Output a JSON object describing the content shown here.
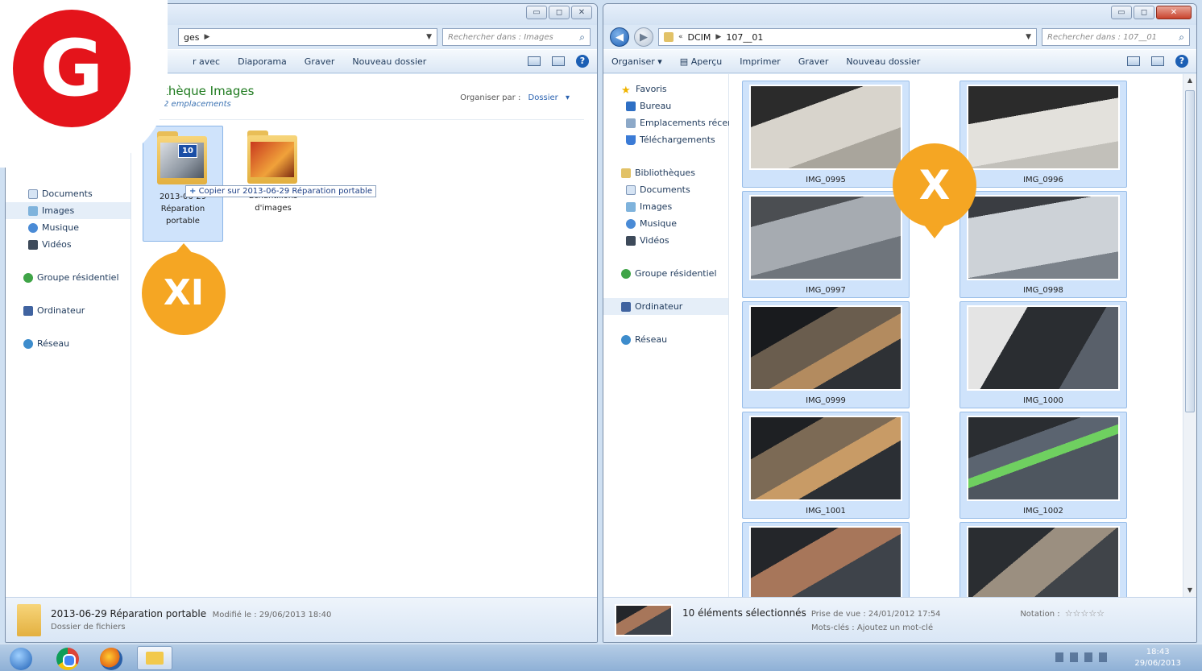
{
  "left_window": {
    "address": "ges",
    "search_placeholder": "Rechercher dans : Images",
    "toolbar": {
      "share": "r avec",
      "slideshow": "Diaporama",
      "burn": "Graver",
      "new_folder": "Nouveau dossier"
    },
    "library_title": "thèque Images",
    "library_sub": "2 emplacements",
    "organize_label": "Organiser par :",
    "organize_value": "Dossier",
    "nav": {
      "documents": "Documents",
      "images": "Images",
      "music": "Musique",
      "videos": "Vidéos",
      "homegroup": "Groupe résidentiel",
      "computer": "Ordinateur",
      "network": "Réseau"
    },
    "folders": [
      {
        "label_line1": "2013-06-29",
        "label_line2": "Réparation",
        "label_line3": "portable",
        "badge": "10"
      },
      {
        "label_line1": "Échantillons",
        "label_line2": "d'images"
      }
    ],
    "tooltip": "Copier sur 2013-06-29 Réparation portable",
    "status": {
      "name": "2013-06-29 Réparation portable",
      "modified": "Modifié le : 29/06/2013 18:40",
      "type": "Dossier de fichiers"
    }
  },
  "right_window": {
    "path": [
      "DCIM",
      "107__01"
    ],
    "search_placeholder": "Rechercher dans : 107__01",
    "toolbar": {
      "organize": "Organiser",
      "preview": "Aperçu",
      "print": "Imprimer",
      "burn": "Graver",
      "new_folder": "Nouveau dossier"
    },
    "nav": {
      "favorites": "Favoris",
      "desktop": "Bureau",
      "recent": "Emplacements récen",
      "downloads": "Téléchargements",
      "libraries": "Bibliothèques",
      "documents": "Documents",
      "images": "Images",
      "music": "Musique",
      "videos": "Vidéos",
      "homegroup": "Groupe résidentiel",
      "computer": "Ordinateur",
      "network": "Réseau"
    },
    "thumbnails": [
      "IMG_0995",
      "IMG_0996",
      "IMG_0997",
      "IMG_0998",
      "IMG_0999",
      "IMG_1000",
      "IMG_1001",
      "IMG_1002",
      "",
      ""
    ],
    "status": {
      "selected": "10 éléments sélectionnés",
      "taken": "Prise de vue : 24/01/2012 17:54",
      "rating": "Notation :",
      "stars": "☆☆☆☆☆",
      "keywords": "Mots-clés : Ajoutez un mot-clé"
    }
  },
  "markers": {
    "x": "X",
    "xi": "XI"
  },
  "logo": "G",
  "taskbar": {
    "time": "18:43",
    "date": "29/06/2013"
  },
  "window_buttons": {
    "minimize": "▭",
    "maximize": "◻",
    "close": "✕"
  },
  "colors": {
    "marker": "#f5a623",
    "logo": "#e4141b",
    "selection": "#cfe3fb"
  }
}
